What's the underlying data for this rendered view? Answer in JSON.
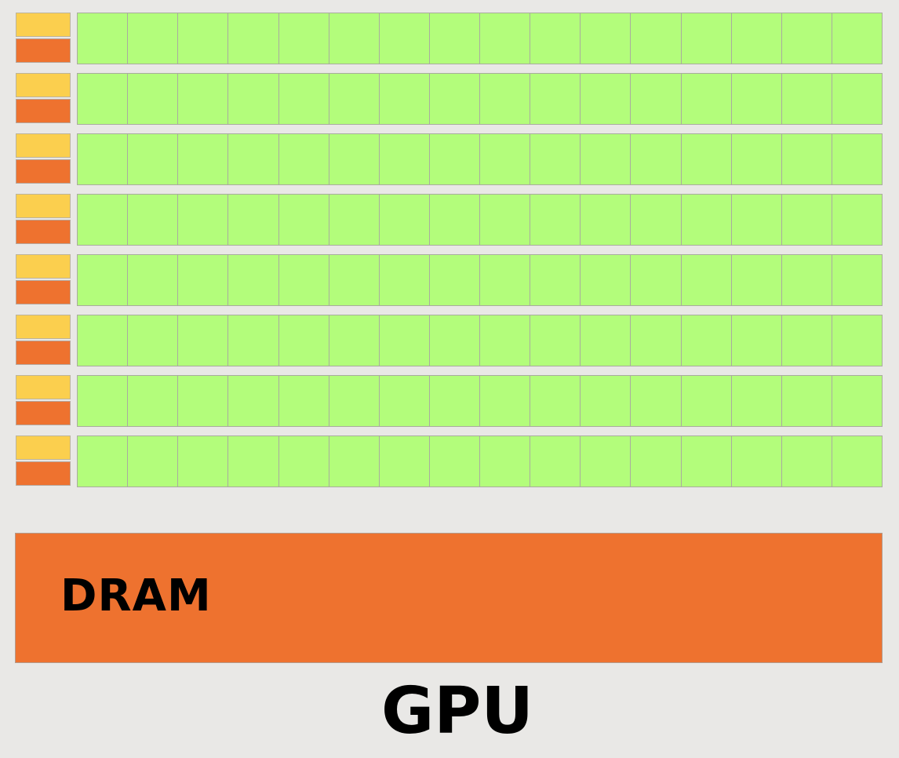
{
  "diagram": {
    "label": "GPU",
    "memory_label": "DRAM",
    "row_count": 8,
    "cores_per_row": 16,
    "colors": {
      "background": "#e9e8e6",
      "control": "#fbcf4e",
      "cache": "#ee722f",
      "core": "#b3fd7b",
      "dram": "#ee722f",
      "text": "#000000"
    }
  }
}
